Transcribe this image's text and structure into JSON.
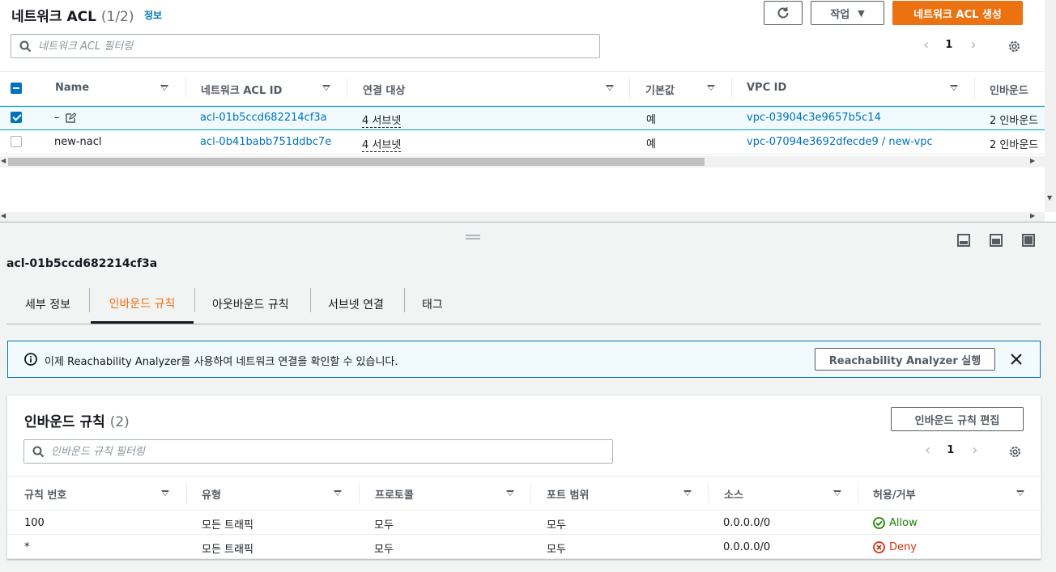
{
  "acl_list": {
    "title": "네트워크 ACL",
    "count": "(1/2)",
    "info_link": "정보",
    "refresh_label": "",
    "actions_label": "작업",
    "create_label": "네트워크 ACL 생성",
    "filter_placeholder": "네트워크 ACL 필터링",
    "page": "1",
    "columns": [
      "Name",
      "네트워크 ACL ID",
      "연결 대상",
      "기본값",
      "VPC ID",
      "인바운드"
    ],
    "rows": [
      {
        "name": "–",
        "acl_id": "acl-01b5ccd682214cf3a",
        "assoc": "4 서브넷",
        "default": "예",
        "vpc": "vpc-03904c3e9657b5c14",
        "inbound": "2 인바운드",
        "selected": true
      },
      {
        "name": "new-nacl",
        "acl_id": "acl-0b41babb751ddbc7e",
        "assoc": "4 서브넷",
        "default": "예",
        "vpc": "vpc-07094e3692dfecde9 / new-vpc",
        "inbound": "2 인바운드",
        "selected": false
      }
    ]
  },
  "detail": {
    "selected_id": "acl-01b5ccd682214cf3a",
    "tabs": [
      "세부 정보",
      "인바운드 규칙",
      "아웃바운드 규칙",
      "서브넷 연결",
      "태그"
    ],
    "active_tab": 1
  },
  "banner": {
    "text": "이제 Reachability Analyzer를 사용하여 네트워크 연결을 확인할 수 있습니다.",
    "button": "Reachability Analyzer 실행"
  },
  "inbound": {
    "title": "인바운드 규칙",
    "count": "(2)",
    "edit_label": "인바운드 규칙 편집",
    "filter_placeholder": "인바운드 규칙 필터링",
    "page": "1",
    "columns": [
      "규칙 번호",
      "유형",
      "프로토콜",
      "포트 범위",
      "소스",
      "허용/거부"
    ],
    "rows": [
      {
        "rule": "100",
        "type": "모든 트래픽",
        "protocol": "모두",
        "port": "모두",
        "source": "0.0.0.0/0",
        "action": "Allow"
      },
      {
        "rule": "*",
        "type": "모든 트래픽",
        "protocol": "모두",
        "port": "모두",
        "source": "0.0.0.0/0",
        "action": "Deny"
      }
    ]
  },
  "colors": {
    "accent": "#ec7211",
    "link": "#0073bb",
    "allow": "#1d8102",
    "deny": "#d13212"
  }
}
